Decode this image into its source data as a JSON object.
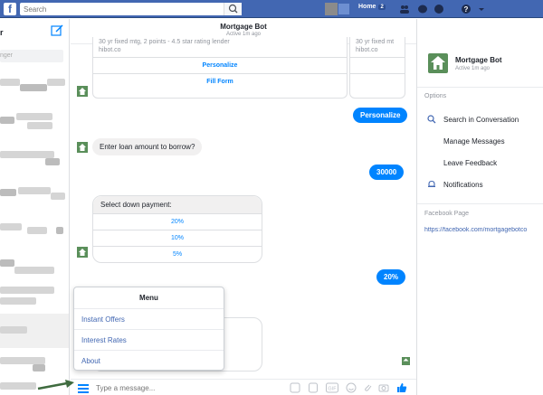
{
  "topbar": {
    "search_placeholder": "Search",
    "home_label": "Home",
    "home_badge": "2",
    "colors": {
      "bar": "#4267b2"
    }
  },
  "sidebar": {
    "title": "r",
    "search_placeholder": "nger"
  },
  "chat": {
    "name": "Mortgage Bot",
    "status": "Active 1m ago",
    "card": {
      "subtitle_a": "30 yr fixed mtg, 2 points - 4.5 star rating lender",
      "subtitle_b": "30 yr fixed mt",
      "link_a": "hibot.co",
      "link_b": "hibot.co",
      "buttons": [
        "Personalize",
        "Fill Form"
      ]
    },
    "messages": {
      "out_personalize": "Personalize",
      "in_loan": "Enter loan amount to borrow?",
      "out_amount": "30000",
      "down_payment_prompt": "Select down payment:",
      "down_payment_options": [
        "20%",
        "10%",
        "5%"
      ],
      "out_percent": "20%"
    },
    "menu": {
      "title": "Menu",
      "items": [
        "Instant Offers",
        "Interest Rates",
        "About"
      ]
    },
    "composer": {
      "placeholder": "Type a message..."
    },
    "accent": "#0084ff"
  },
  "right": {
    "name": "Mortgage Bot",
    "status": "Active 1m ago",
    "options_label": "Options",
    "options": [
      "Search in Conversation",
      "Manage Messages",
      "Leave Feedback",
      "Notifications"
    ],
    "page_label": "Facebook Page",
    "page_link": "https://facebook.com/mortgagebotco"
  }
}
